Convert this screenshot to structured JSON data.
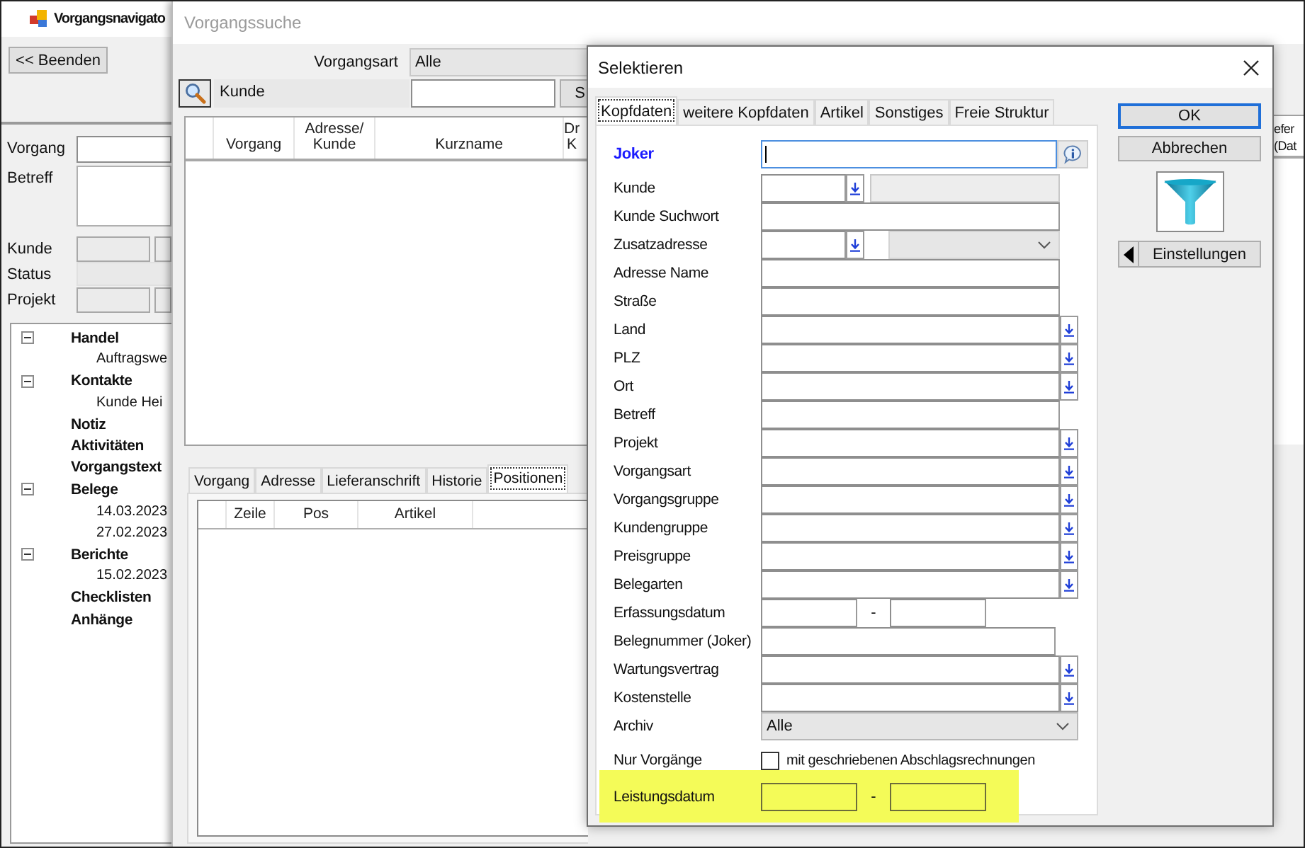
{
  "navigator": {
    "title": "Vorgangsnavigato",
    "close_button": "<< Beenden",
    "fields": [
      {
        "label": "Vorgang",
        "kind": "text"
      },
      {
        "label": "Betreff",
        "kind": "memo"
      },
      {
        "label": "Kunde",
        "kind": "split"
      },
      {
        "label": "Status",
        "kind": "readonly"
      },
      {
        "label": "Projekt",
        "kind": "split"
      }
    ],
    "tree": [
      {
        "label": "Handel",
        "expanded": true,
        "children": [
          {
            "label": "Auftragswe"
          }
        ]
      },
      {
        "label": "Kontakte",
        "expanded": true,
        "children": [
          {
            "label": "Kunde Hei"
          }
        ]
      },
      {
        "label": "Notiz"
      },
      {
        "label": "Aktivitäten"
      },
      {
        "label": "Vorgangstext"
      },
      {
        "label": "Belege",
        "expanded": true,
        "children": [
          {
            "label": "14.03.2023"
          },
          {
            "label": "27.02.2023"
          }
        ]
      },
      {
        "label": "Berichte",
        "expanded": true,
        "children": [
          {
            "label": "15.02.2023"
          }
        ]
      },
      {
        "label": "Checklisten"
      },
      {
        "label": "Anhänge"
      }
    ]
  },
  "search": {
    "title": "Vorgangssuche",
    "type_label": "Vorgangsart",
    "type_value": "Alle",
    "search_field_label": "Kunde",
    "search_button": "S",
    "columns": [
      "Vorgang",
      "Adresse/\nKunde",
      "Kurzname",
      "Dr\nK"
    ],
    "right_column": "efer\n(Dat",
    "tabs": [
      {
        "label": "Vorgang",
        "selected": false
      },
      {
        "label": "Adresse",
        "selected": false
      },
      {
        "label": "Lieferanschrift",
        "selected": false
      },
      {
        "label": "Historie",
        "selected": false
      },
      {
        "label": "Positionen",
        "selected": true
      }
    ],
    "position_columns": [
      "Zeile",
      "Pos",
      "Artikel"
    ]
  },
  "dialog": {
    "title": "Selektieren",
    "tabs": [
      {
        "label": "Kopfdaten",
        "selected": true
      },
      {
        "label": "weitere Kopfdaten",
        "selected": false
      },
      {
        "label": "Artikel",
        "selected": false
      },
      {
        "label": "Sonstiges",
        "selected": false
      },
      {
        "label": "Freie Struktur",
        "selected": false
      }
    ],
    "rows": [
      {
        "label": "Joker",
        "kind": "joker",
        "highlighted": false
      },
      {
        "label": "Kunde",
        "kind": "lookup_split",
        "highlighted": false
      },
      {
        "label": "Kunde Suchwort",
        "kind": "text",
        "highlighted": false
      },
      {
        "label": "Zusatzadresse",
        "kind": "lookup_combo",
        "highlighted": false
      },
      {
        "label": "Adresse Name",
        "kind": "text",
        "highlighted": false
      },
      {
        "label": "Straße",
        "kind": "text",
        "highlighted": false
      },
      {
        "label": "Land",
        "kind": "lookup",
        "highlighted": false
      },
      {
        "label": "PLZ",
        "kind": "lookup",
        "highlighted": false
      },
      {
        "label": "Ort",
        "kind": "lookup",
        "highlighted": false
      },
      {
        "label": "Betreff",
        "kind": "text",
        "highlighted": false
      },
      {
        "label": "Projekt",
        "kind": "lookup",
        "highlighted": false
      },
      {
        "label": "Vorgangsart",
        "kind": "lookup",
        "highlighted": false
      },
      {
        "label": "Vorgangsgruppe",
        "kind": "lookup",
        "highlighted": false
      },
      {
        "label": "Kundengruppe",
        "kind": "lookup",
        "highlighted": false
      },
      {
        "label": "Preisgruppe",
        "kind": "lookup",
        "highlighted": false
      },
      {
        "label": "Belegarten",
        "kind": "lookup",
        "highlighted": false
      },
      {
        "label": "Erfassungsdatum",
        "kind": "date_range",
        "separator": "-",
        "highlighted": false
      },
      {
        "label": "Belegnummer (Joker)",
        "kind": "text_short",
        "highlighted": false
      },
      {
        "label": "Wartungsvertrag",
        "kind": "lookup",
        "highlighted": false
      },
      {
        "label": "Kostenstelle",
        "kind": "lookup",
        "highlighted": false
      },
      {
        "label": "Archiv",
        "kind": "combo",
        "value": "Alle",
        "highlighted": false
      },
      {
        "label": "Nur Vorgänge",
        "kind": "checkbox",
        "checked": false,
        "text": "mit geschriebenen Abschlagsrechnungen",
        "highlighted": false
      },
      {
        "label": "Leistungsdatum",
        "kind": "date_range",
        "separator": "-",
        "highlighted": true
      }
    ],
    "ok_button": "OK",
    "cancel_button": "Abbrechen",
    "settings_button": "Einstellungen"
  }
}
